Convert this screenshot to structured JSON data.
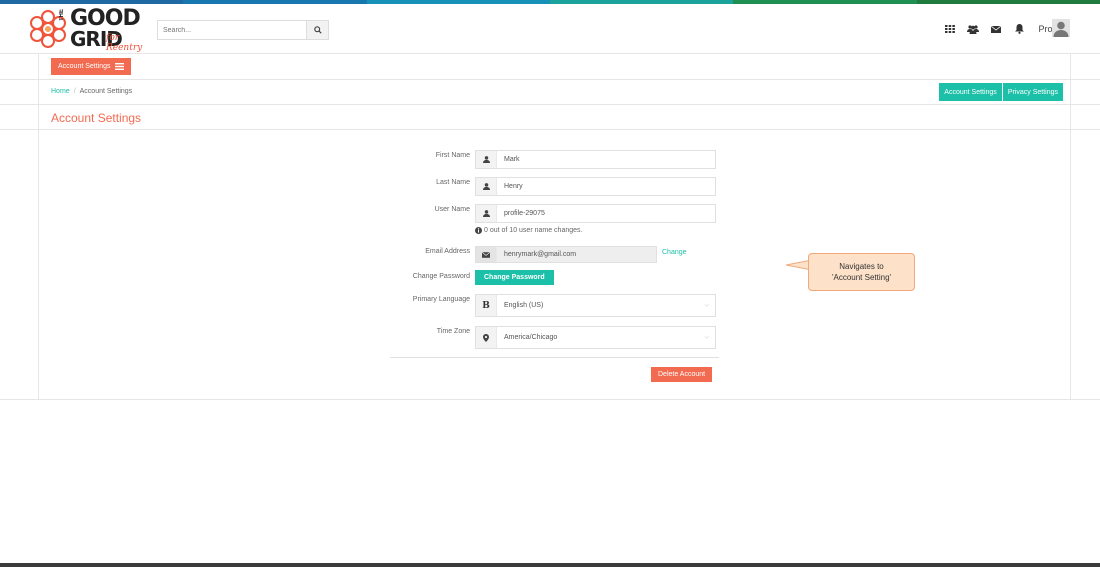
{
  "colors": {
    "accent": "#f26b50",
    "teal": "#1cbfa7",
    "stripe": [
      "#1f6aa5",
      "#1778b0",
      "#1691b7",
      "#1aa39d",
      "#1f8f52",
      "#1f7a3e"
    ]
  },
  "header": {
    "logo": {
      "the": "THE",
      "line1": "GOOD",
      "line2": "GRID",
      "script": "for Reentry"
    },
    "search": {
      "placeholder": "Search..."
    },
    "nav": {
      "profile_label": "Profile"
    },
    "icons": [
      "grid-icon",
      "users-icon",
      "envelope-icon",
      "bell-icon",
      "user-avatar-icon"
    ]
  },
  "toolbar": {
    "account_settings_label": "Account Settings"
  },
  "breadcrumb": {
    "home": "Home",
    "separator": "/",
    "current": "Account Settings"
  },
  "right_buttons": {
    "account_settings": "Account Settings",
    "privacy_settings": "Privacy Settings"
  },
  "page": {
    "title": "Account Settings"
  },
  "form": {
    "first_name": {
      "label": "First Name",
      "value": "Mark"
    },
    "last_name": {
      "label": "Last Name",
      "value": "Henry"
    },
    "user_name": {
      "label": "User Name",
      "value": "profile-29075",
      "hint": "0 out of 10 user name changes."
    },
    "email": {
      "label": "Email Address",
      "value": "henrymark@gmail.com",
      "change_link": "Change"
    },
    "password": {
      "label": "Change Password",
      "button": "Change Password"
    },
    "language": {
      "label": "Primary Language",
      "value": "English (US)"
    },
    "timezone": {
      "label": "Time Zone",
      "value": "America/Chicago"
    },
    "delete_button": "Delete Account"
  },
  "callout": {
    "line1": "Navigates to",
    "line2": "'Account Setting'"
  }
}
